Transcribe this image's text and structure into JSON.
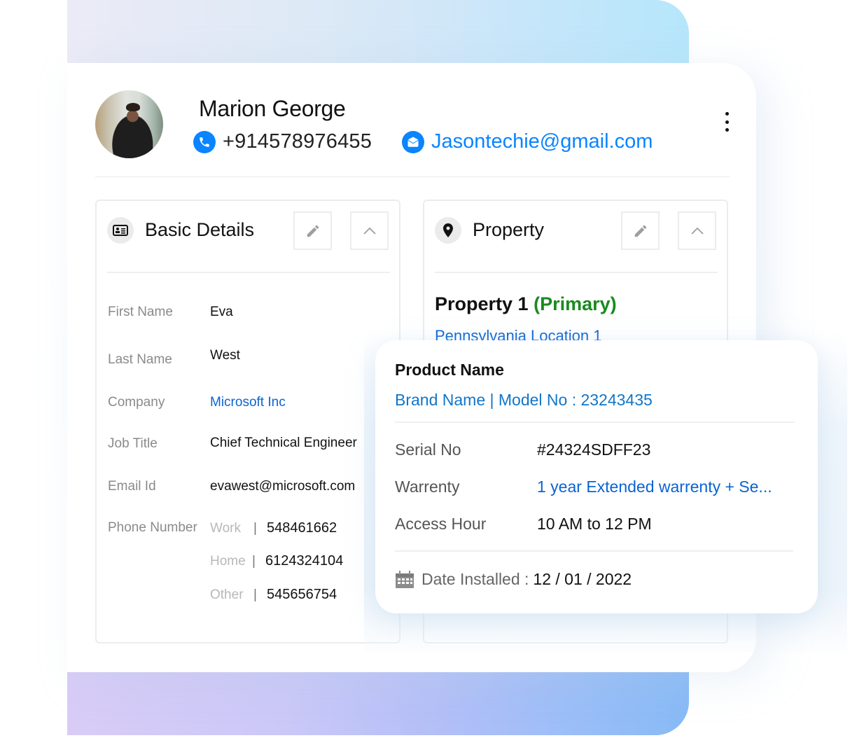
{
  "contact": {
    "name": "Marion George",
    "phone": "+914578976455",
    "email": "Jasontechie@gmail.com"
  },
  "basic_details": {
    "title": "Basic Details",
    "fields": [
      {
        "label": "First Name",
        "value": "Eva"
      },
      {
        "label": "Last Name",
        "value": "West"
      },
      {
        "label": "Company",
        "value": "Microsoft Inc"
      },
      {
        "label": "Job Title",
        "value": "Chief Technical Engineer"
      },
      {
        "label": "Email Id",
        "value": "evawest@microsoft.com"
      }
    ],
    "phone_label": "Phone Number",
    "phones": [
      {
        "type": "Work",
        "sep": "|",
        "number": "548461662"
      },
      {
        "type": "Home",
        "sep": "|",
        "number": "6124324104"
      },
      {
        "type": "Other",
        "sep": "|",
        "number": "545656754"
      }
    ]
  },
  "property": {
    "title": "Property",
    "property_name": "Property 1",
    "primary_tag": "(Primary)",
    "location": "Pennsylvania Location 1"
  },
  "product": {
    "name": "Product Name",
    "model_line": "Brand Name | Model No : 23243435",
    "rows": [
      {
        "label": "Serial No",
        "value": "#24324SDFF23"
      },
      {
        "label": "Warrenty",
        "value": "1 year Extended warrenty + Se..."
      },
      {
        "label": "Access Hour",
        "value": "10 AM to 12 PM"
      }
    ],
    "date_label": "Date Installed :",
    "date_value": "12 / 01 / 2022"
  },
  "colors": {
    "accent_blue": "#0a84ff",
    "link_blue": "#0b63d3",
    "primary_green": "#198a1f"
  }
}
